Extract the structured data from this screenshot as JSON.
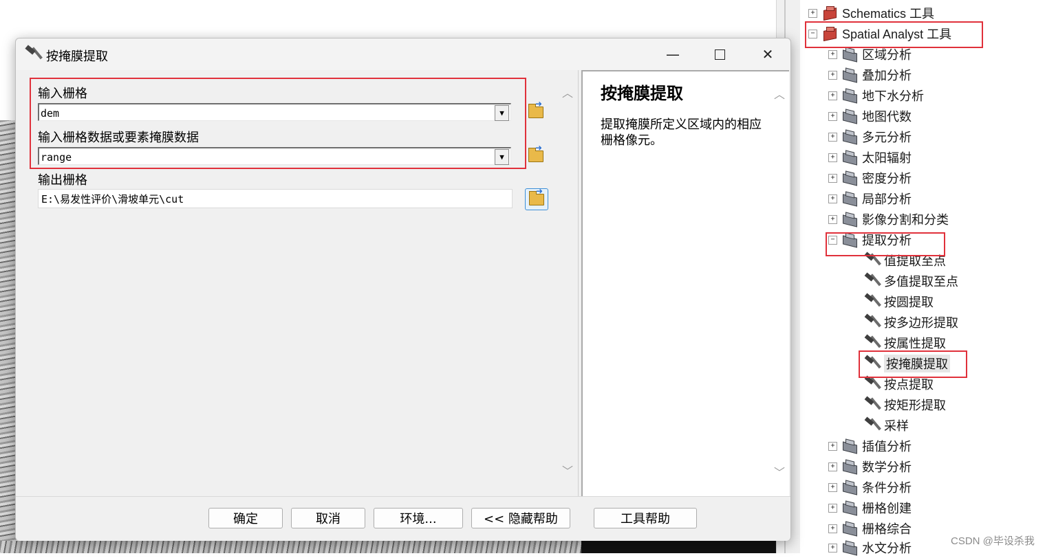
{
  "dialog": {
    "title": "按掩膜提取",
    "fields": [
      {
        "label": "输入栅格",
        "value": "dem"
      },
      {
        "label": "输入栅格数据或要素掩膜数据",
        "value": "range"
      },
      {
        "label": "输出栅格",
        "value": "E:\\易发性评价\\滑坡单元\\cut"
      }
    ],
    "help": {
      "title": "按掩膜提取",
      "text": "提取掩膜所定义区域内的相应栅格像元。"
    },
    "buttons": {
      "ok": "确定",
      "cancel": "取消",
      "env": "环境...",
      "hide_help": "<< 隐藏帮助",
      "tool_help": "工具帮助"
    }
  },
  "tree": {
    "toolboxes": [
      {
        "label": "Schematics 工具",
        "expanded": false
      },
      {
        "label": "Spatial Analyst 工具",
        "expanded": true
      }
    ],
    "toolsets": [
      {
        "label": "区域分析"
      },
      {
        "label": "叠加分析"
      },
      {
        "label": "地下水分析"
      },
      {
        "label": "地图代数"
      },
      {
        "label": "多元分析"
      },
      {
        "label": "太阳辐射"
      },
      {
        "label": "密度分析"
      },
      {
        "label": "局部分析"
      },
      {
        "label": "影像分割和分类"
      },
      {
        "label": "提取分析"
      }
    ],
    "tools": [
      {
        "label": "值提取至点"
      },
      {
        "label": "多值提取至点"
      },
      {
        "label": "按圆提取"
      },
      {
        "label": "按多边形提取"
      },
      {
        "label": "按属性提取"
      },
      {
        "label": "按掩膜提取",
        "selected": true
      },
      {
        "label": "按点提取"
      },
      {
        "label": "按矩形提取"
      },
      {
        "label": "采样"
      }
    ],
    "toolsets_after": [
      {
        "label": "插值分析"
      },
      {
        "label": "数学分析"
      },
      {
        "label": "条件分析"
      },
      {
        "label": "栅格创建"
      },
      {
        "label": "栅格综合"
      },
      {
        "label": "水文分析"
      }
    ]
  },
  "watermark": "CSDN @毕设杀我",
  "colors": {
    "highlight_box": "#e0303a"
  }
}
